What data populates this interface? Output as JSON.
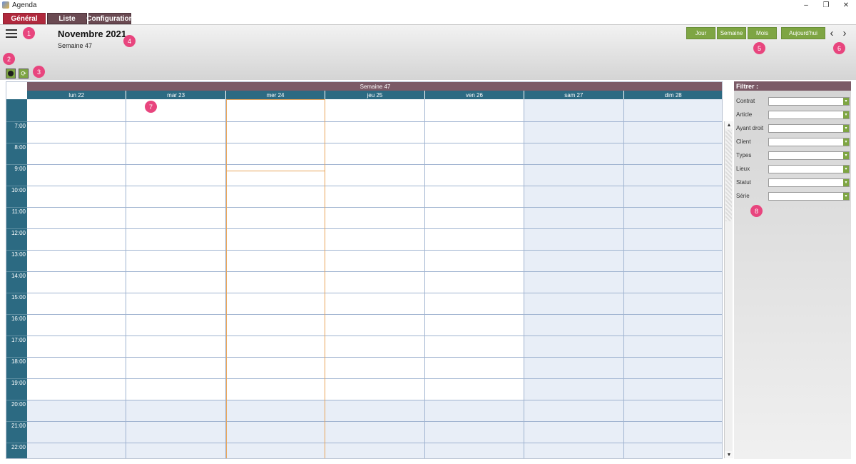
{
  "window": {
    "title": "Agenda",
    "controls": {
      "minimize": "–",
      "restore": "❐",
      "close": "✕"
    }
  },
  "tabs": [
    {
      "label": "Général",
      "active": true
    },
    {
      "label": "Liste",
      "active": false
    },
    {
      "label": "Configuration",
      "active": false
    }
  ],
  "header": {
    "title": "Novembre 2021",
    "subtitle": "Semaine 47"
  },
  "view_buttons": {
    "day": "Jour",
    "week": "Semaine",
    "month": "Mois",
    "today": "Aujourd'hui"
  },
  "nav": {
    "prev": "‹",
    "next": "›"
  },
  "tools": {
    "add_icon": "plus-circle-icon",
    "refresh_icon": "refresh-icon",
    "refresh_glyph": "⟳"
  },
  "callouts": [
    "1",
    "2",
    "3",
    "4",
    "5",
    "6",
    "7",
    "8"
  ],
  "calendar": {
    "week_banner": "Semaine 47",
    "days": [
      "lun 22",
      "mar 23",
      "mer 24",
      "jeu 25",
      "ven 26",
      "sam 27",
      "dim 28"
    ],
    "hours": [
      "7:00",
      "8:00",
      "9:00",
      "10:00",
      "11:00",
      "12:00",
      "13:00",
      "14:00",
      "15:00",
      "16:00",
      "17:00",
      "18:00",
      "19:00",
      "20:00",
      "21:00",
      "22:00"
    ],
    "today_day": "mer 24"
  },
  "scrollbar": {
    "up": "▲",
    "down": "▼"
  },
  "filter": {
    "heading": "Filtrer :",
    "fields": [
      {
        "label": "Contrat",
        "value": ""
      },
      {
        "label": "Article",
        "value": ""
      },
      {
        "label": "Ayant droit",
        "value": ""
      },
      {
        "label": "Client",
        "value": ""
      },
      {
        "label": "Types",
        "value": ""
      },
      {
        "label": "Lieux",
        "value": ""
      },
      {
        "label": "Statut",
        "value": ""
      },
      {
        "label": "Série",
        "value": ""
      }
    ],
    "dropdown_glyph": "▾"
  },
  "colors": {
    "tab_active": "#b0293d",
    "tab_inactive": "#6a4a52",
    "action_green": "#7ea543",
    "day_header": "#2c6a82",
    "banner": "#7b5a66",
    "today_outline": "#e8a55a",
    "callout": "#e8457e"
  }
}
